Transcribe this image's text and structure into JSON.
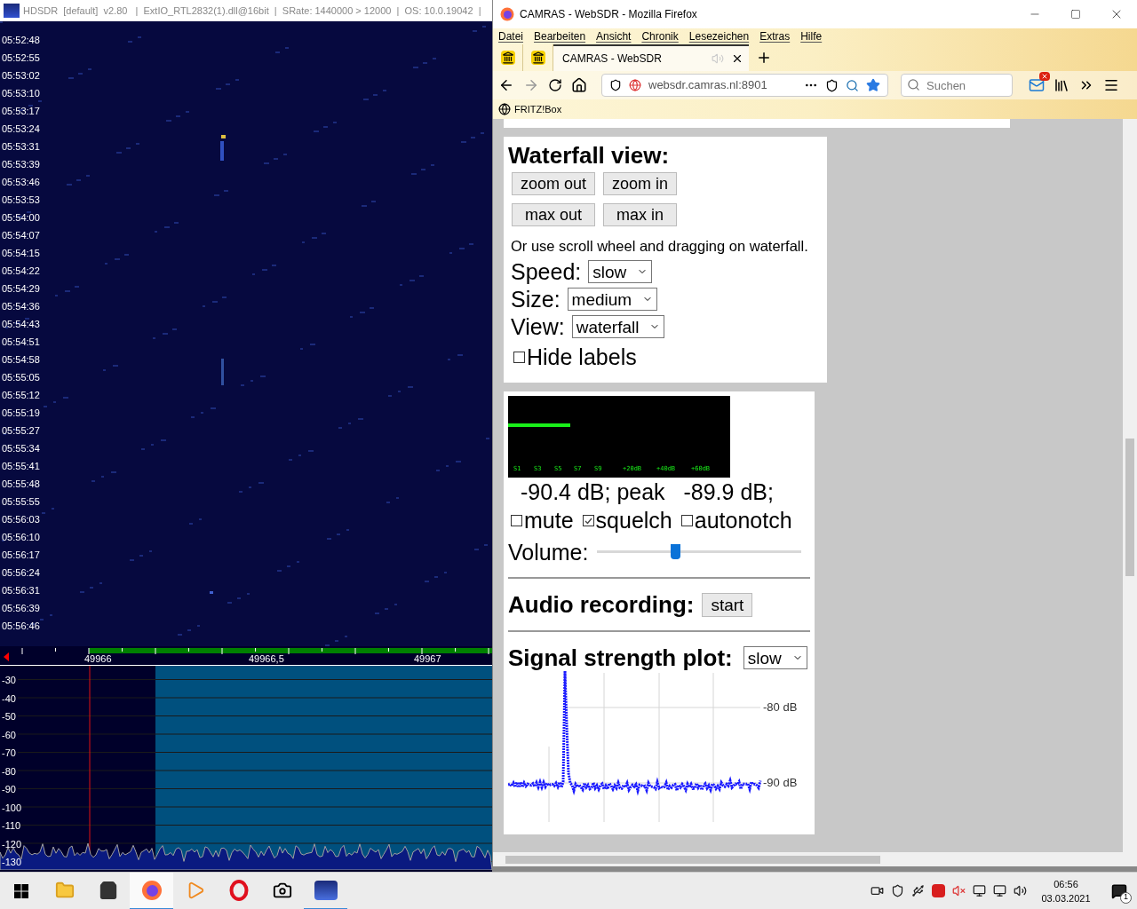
{
  "hdsdr": {
    "title": "HDSDR  [default]  v2.80   |  ExtIO_RTL2832(1).dll@16bit  |  SRate: 1440000 > 12000  |  OS: 10.0.19042  |",
    "timestamps": [
      "05:52:48",
      "05:52:55",
      "05:53:02",
      "05:53:10",
      "05:53:17",
      "05:53:24",
      "05:53:31",
      "05:53:39",
      "05:53:46",
      "05:53:53",
      "05:54:00",
      "05:54:07",
      "05:54:15",
      "05:54:22",
      "05:54:29",
      "05:54:36",
      "05:54:43",
      "05:54:51",
      "05:54:58",
      "05:55:05",
      "05:55:12",
      "05:55:19",
      "05:55:27",
      "05:55:34",
      "05:55:41",
      "05:55:48",
      "05:55:55",
      "05:56:03",
      "05:56:10",
      "05:56:17",
      "05:56:24",
      "05:56:31",
      "05:56:39",
      "05:56:46"
    ],
    "frequency_labels": [
      "49966",
      "49966,5",
      "49967"
    ],
    "level_labels": [
      "-30",
      "-40",
      "-50",
      "-60",
      "-70",
      "-80",
      "-90",
      "-100",
      "-110",
      "-120",
      "-130"
    ]
  },
  "firefox": {
    "title": "CAMRAS - WebSDR - Mozilla Firefox",
    "menu": [
      "Datei",
      "Bearbeiten",
      "Ansicht",
      "Chronik",
      "Lesezeichen",
      "Extras",
      "Hilfe"
    ],
    "tabs": [
      {
        "kind": "pinned",
        "selected": false
      },
      {
        "kind": "pinned",
        "selected": false
      },
      {
        "kind": "page",
        "label": "CAMRAS - WebSDR",
        "selected": true
      }
    ],
    "url": "websdr.camras.nl:8901",
    "search": {
      "placeholder": "Suchen"
    },
    "bookmarks": [
      "FRITZ!Box"
    ]
  },
  "page": {
    "waterfall": {
      "heading": "Waterfall view:",
      "buttons": [
        "zoom out",
        "zoom in",
        "max out",
        "max in"
      ],
      "hint": "Or use scroll wheel and dragging on waterfall.",
      "selects": [
        {
          "label": "Speed:",
          "value": "slow"
        },
        {
          "label": "Size:",
          "value": "medium"
        },
        {
          "label": "View:",
          "value": "waterfall"
        }
      ],
      "hide_labels": {
        "label": "Hide labels",
        "checked": false
      }
    },
    "receiver": {
      "smeter": {
        "level": 0.28,
        "scale": [
          "S1",
          "S3",
          "S5",
          "S7",
          "S9",
          "+20dB",
          "+40dB",
          "+60dB"
        ]
      },
      "reading": "-90.4 dB; peak   -89.9 dB;",
      "options": [
        {
          "label": "mute",
          "checked": false
        },
        {
          "label": "squelch",
          "checked": true
        },
        {
          "label": "autonotch",
          "checked": false
        }
      ],
      "volume": {
        "label": "Volume:",
        "level": 0.38
      },
      "recording": {
        "heading": "Audio recording:",
        "button": "start"
      },
      "plot": {
        "heading": "Signal strength plot:",
        "speed": "slow",
        "tick_labels": [
          "-80 dB",
          "-90 dB"
        ]
      }
    }
  },
  "taskbar": {
    "apps": [
      {
        "kind": "explorer",
        "running": false,
        "selected": false
      },
      {
        "kind": "store",
        "running": false,
        "selected": false
      },
      {
        "kind": "firefox",
        "running": true,
        "selected": true
      },
      {
        "kind": "media",
        "running": false,
        "selected": false
      },
      {
        "kind": "opera",
        "running": false,
        "selected": false
      },
      {
        "kind": "camera",
        "running": false,
        "selected": false
      },
      {
        "kind": "hdsdr",
        "running": true,
        "selected": false
      }
    ],
    "clock": {
      "time": "06:56",
      "date": "03.03.2021"
    },
    "notifications": "1"
  }
}
